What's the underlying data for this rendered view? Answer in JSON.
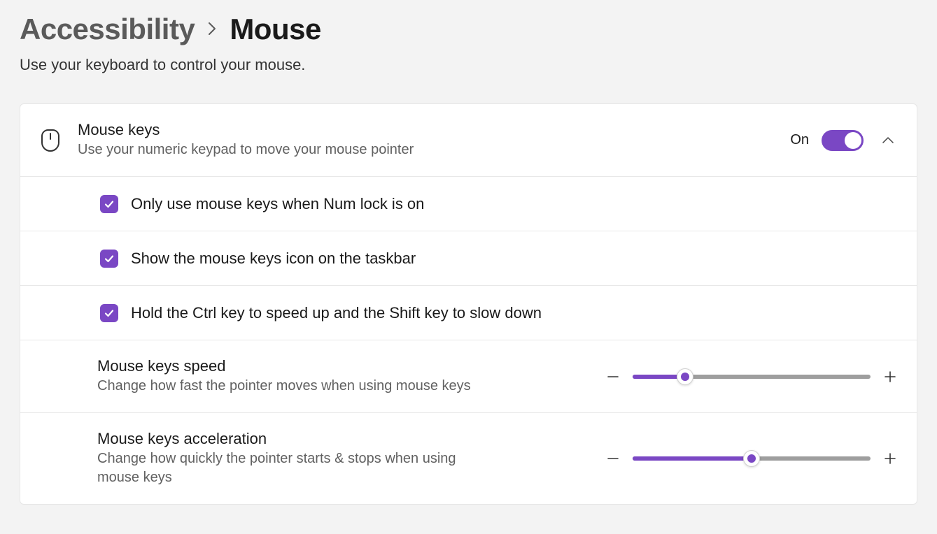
{
  "breadcrumb": {
    "parent": "Accessibility",
    "current": "Mouse"
  },
  "subtitle": "Use your keyboard to control your mouse.",
  "mouseKeys": {
    "title": "Mouse keys",
    "desc": "Use your numeric keypad to move your mouse pointer",
    "toggleStateLabel": "On",
    "toggleOn": true,
    "expanded": true
  },
  "options": {
    "numlock": {
      "label": "Only use mouse keys when Num lock is on",
      "checked": true
    },
    "taskbar": {
      "label": "Show the mouse keys icon on the taskbar",
      "checked": true
    },
    "ctrlshift": {
      "label": "Hold the Ctrl key to speed up and the Shift key to slow down",
      "checked": true
    }
  },
  "speed": {
    "title": "Mouse keys speed",
    "desc": "Change how fast the pointer moves when using mouse keys",
    "percent": 22
  },
  "accel": {
    "title": "Mouse keys acceleration",
    "desc": "Change how quickly the pointer starts & stops when using mouse keys",
    "percent": 50
  },
  "colors": {
    "accent": "#7a47c4"
  }
}
